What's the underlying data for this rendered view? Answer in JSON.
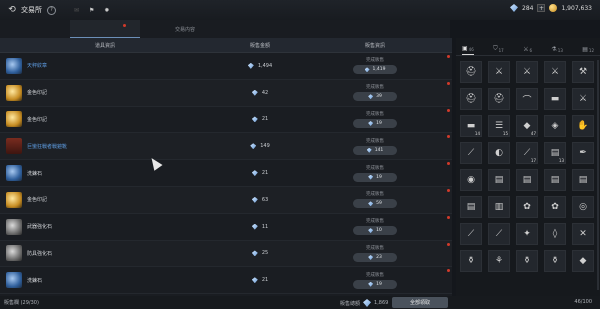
{
  "app": {
    "title": "交易所",
    "help": "?",
    "icons": [
      "back-icon",
      "help-icon",
      "mail-icon",
      "bell-icon"
    ]
  },
  "currency": {
    "gems": "284",
    "coins": "1,907,633",
    "gem_plus": "+"
  },
  "tabs": [
    "",
    "",
    "交易内容"
  ],
  "table": {
    "headers": [
      "道具資訊",
      "販售金額",
      "販售資訊"
    ],
    "rows": [
      {
        "name": "天秤紋章",
        "price": "1,494",
        "status": "完成販售",
        "payout": "1,419",
        "icon": "blue-crest-icon",
        "style": "blue"
      },
      {
        "name": "金色印記",
        "price": "42",
        "status": "完成販售",
        "payout": "39",
        "icon": "gold-seal-icon",
        "style": "normal"
      },
      {
        "name": "金色印記",
        "price": "21",
        "status": "完成販售",
        "payout": "19",
        "icon": "gold-seal-icon",
        "style": "normal"
      },
      {
        "name": "巨蠻狂戰者戰鎧靴",
        "price": "149",
        "status": "完成販售",
        "payout": "141",
        "icon": "armor-boots-icon",
        "style": "blue"
      },
      {
        "name": "洗鍊石",
        "price": "21",
        "status": "完成販售",
        "payout": "19",
        "icon": "blue-stone-icon",
        "style": "normal"
      },
      {
        "name": "金色印記",
        "price": "63",
        "status": "完成販售",
        "payout": "59",
        "icon": "gold-seal-icon",
        "style": "normal"
      },
      {
        "name": "武器強化石",
        "price": "11",
        "status": "完成販售",
        "payout": "10",
        "icon": "weapon-stone-icon",
        "style": "normal"
      },
      {
        "name": "防具強化石",
        "price": "25",
        "status": "完成販售",
        "payout": "23",
        "icon": "armor-stone-icon",
        "style": "normal"
      },
      {
        "name": "洗鍊石",
        "price": "21",
        "status": "完成販售",
        "payout": "19",
        "icon": "blue-stone-icon",
        "style": "normal"
      }
    ]
  },
  "bottom": {
    "count": "販售欄 (29/30)",
    "total_label": "販售總額",
    "total": "1,869",
    "collect": "全部領取",
    "inv_count": "46/100"
  },
  "inventory": {
    "tabs": [
      {
        "label": "▣",
        "count": "46"
      },
      {
        "label": "⛉",
        "count": "17"
      },
      {
        "label": "⚔",
        "count": "6"
      },
      {
        "label": "⚗",
        "count": "13"
      },
      {
        "label": "▤",
        "count": "12"
      }
    ],
    "cells": [
      {
        "g": "⛑",
        "q": ""
      },
      {
        "g": "⚔",
        "q": ""
      },
      {
        "g": "⚔",
        "q": ""
      },
      {
        "g": "⚔",
        "q": ""
      },
      {
        "g": "⚒",
        "q": ""
      },
      {
        "g": "⛑",
        "q": ""
      },
      {
        "g": "⛑",
        "q": ""
      },
      {
        "g": "⌒",
        "q": ""
      },
      {
        "g": "▬",
        "q": ""
      },
      {
        "g": "⚔",
        "q": ""
      },
      {
        "g": "▬",
        "q": "14"
      },
      {
        "g": "☰",
        "q": "15"
      },
      {
        "g": "◆",
        "q": "47"
      },
      {
        "g": "◈",
        "q": ""
      },
      {
        "g": "✋",
        "q": ""
      },
      {
        "g": "⟋",
        "q": ""
      },
      {
        "g": "◐",
        "q": ""
      },
      {
        "g": "⟋",
        "q": "17"
      },
      {
        "g": "▤",
        "q": "13"
      },
      {
        "g": "✒",
        "q": ""
      },
      {
        "g": "◉",
        "q": ""
      },
      {
        "g": "▤",
        "q": ""
      },
      {
        "g": "▤",
        "q": ""
      },
      {
        "g": "▤",
        "q": ""
      },
      {
        "g": "▤",
        "q": ""
      },
      {
        "g": "▤",
        "q": ""
      },
      {
        "g": "▥",
        "q": ""
      },
      {
        "g": "✿",
        "q": ""
      },
      {
        "g": "✿",
        "q": ""
      },
      {
        "g": "◎",
        "q": ""
      },
      {
        "g": "⟋",
        "q": ""
      },
      {
        "g": "⟋",
        "q": ""
      },
      {
        "g": "✦",
        "q": ""
      },
      {
        "g": "◊",
        "q": ""
      },
      {
        "g": "✕",
        "q": ""
      },
      {
        "g": "⚱",
        "q": ""
      },
      {
        "g": "⚘",
        "q": ""
      },
      {
        "g": "⚱",
        "q": ""
      },
      {
        "g": "⚱",
        "q": ""
      },
      {
        "g": "◆",
        "q": ""
      }
    ]
  }
}
